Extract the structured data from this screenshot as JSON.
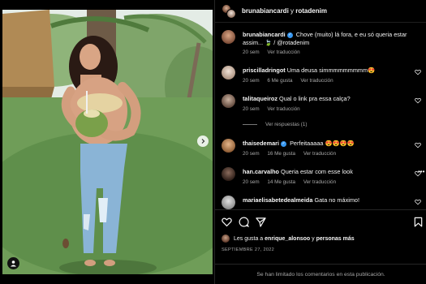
{
  "header": {
    "user1": "brunabiancardi",
    "conjunction": "y",
    "user2": "rotadenim"
  },
  "comments": [
    {
      "user": "brunabiancardi",
      "verified": true,
      "text": "Chove (muito) lá fora, e eu só queria estar assim... 🍃 / @rotadenim",
      "time": "20 sem",
      "likes": "",
      "reply": "Ver traducción",
      "avatar_color": "#7a4a35",
      "has_heart": false
    },
    {
      "user": "priscilladringot",
      "verified": false,
      "text": "Uma deusa simmmmmmmmm😍",
      "time": "20 sem",
      "likes": "6 Me gusta",
      "reply": "Ver traducción",
      "avatar_color": "#d9c2b0",
      "has_heart": true
    },
    {
      "user": "talitaqueiroz",
      "verified": false,
      "text": "Qual o link pra essa calça?",
      "time": "20 sem",
      "likes": "",
      "reply": "Ver traducción",
      "avatar_color": "#8a7060",
      "has_heart": true
    },
    {
      "user": "thaisedemari",
      "verified": true,
      "text": "Perfeitaaaaa 😍😍😍😍",
      "time": "20 sem",
      "likes": "16 Me gusta",
      "reply": "Ver traducción",
      "avatar_color": "#c8905f",
      "has_heart": true
    },
    {
      "user": "han.carvalho",
      "verified": false,
      "text": "Queria estar com esse look",
      "time": "20 sem",
      "likes": "14 Me gusta",
      "reply": "Ver traducción",
      "avatar_color": "#3c2a22",
      "has_heart": true
    },
    {
      "user": "mariaelisabetedealmeida",
      "verified": false,
      "text": "Gata no máximo!",
      "time": "",
      "likes": "",
      "reply": "",
      "avatar_color": "#b0b0b0",
      "has_heart": true
    }
  ],
  "view_replies": "Ver respuestas (1)",
  "likes_line": {
    "prefix": "Les gusta a",
    "user": "enrique_alonsoo",
    "suffix": "y",
    "others": "personas más"
  },
  "date": "SEPTIEMBRE 27, 2022",
  "footer_text": "Se han limitado los comentarios en esta publicación.",
  "more_icon": "•••",
  "icons": [
    "heart-icon",
    "comment-icon",
    "share-icon",
    "bookmark-icon",
    "user-tag-icon",
    "chevron-right-icon"
  ],
  "colors": {
    "verified": "#3797f0",
    "background": "#000000",
    "muted": "#a8a8a8"
  }
}
